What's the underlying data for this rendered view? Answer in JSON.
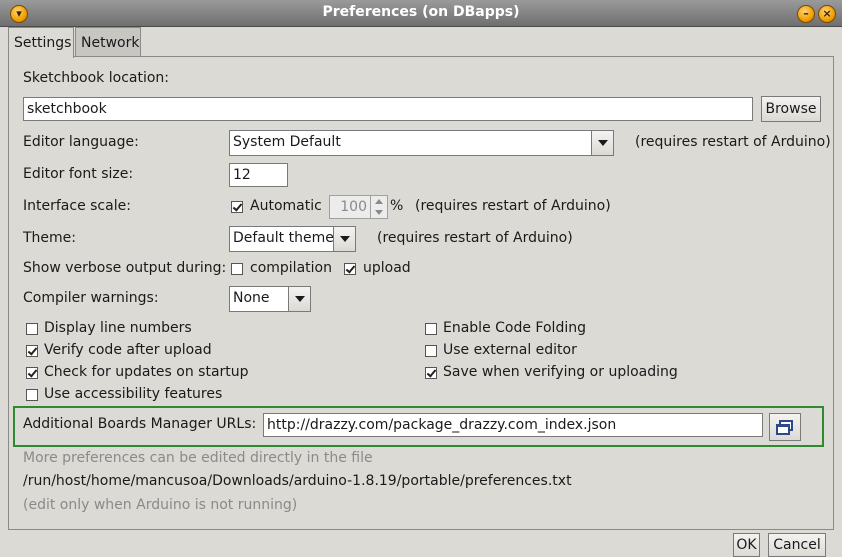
{
  "window": {
    "title": "Preferences (on DBapps)",
    "menu_icon": "chevron-down-icon",
    "minimize_icon": "minimize-icon",
    "close_icon": "close-icon"
  },
  "tabs": [
    {
      "label": "Settings",
      "active": true
    },
    {
      "label": "Network",
      "active": false
    }
  ],
  "settings": {
    "sketchbook_label": "Sketchbook location:",
    "sketchbook_value": "sketchbook",
    "browse_label": "Browse",
    "editor_language_label": "Editor language:",
    "editor_language_value": "System Default",
    "restart_note": "(requires restart of Arduino)",
    "font_size_label": "Editor font size:",
    "font_size_value": "12",
    "interface_scale_label": "Interface scale:",
    "automatic_label": "Automatic",
    "automatic_checked": true,
    "scale_value": "100",
    "percent": "%",
    "theme_label": "Theme:",
    "theme_value": "Default theme",
    "verbose_label": "Show verbose output during:",
    "compilation_label": "compilation",
    "compilation_checked": false,
    "upload_label": "upload",
    "upload_checked": true,
    "compiler_warnings_label": "Compiler warnings:",
    "compiler_warnings_value": "None",
    "left_options": [
      {
        "label": "Display line numbers",
        "checked": false
      },
      {
        "label": "Verify code after upload",
        "checked": true
      },
      {
        "label": "Check for updates on startup",
        "checked": true
      },
      {
        "label": "Use accessibility features",
        "checked": false
      }
    ],
    "right_options": [
      {
        "label": "Enable Code Folding",
        "checked": false
      },
      {
        "label": "Use external editor",
        "checked": false
      },
      {
        "label": "Save when verifying or uploading",
        "checked": true
      }
    ],
    "boards_urls_label": "Additional Boards Manager URLs:",
    "boards_urls_value": "http://drazzy.com/package_drazzy.com_index.json",
    "boards_urls_button_icon": "window-stack-icon",
    "more_prefs_note": "More preferences can be edited directly in the file",
    "prefs_path": "/run/host/home/mancusoa/Downloads/arduino-1.8.19/portable/preferences.txt",
    "edit_note": "(edit only when Arduino is not running)"
  },
  "footer": {
    "ok_label": "OK",
    "cancel_label": "Cancel"
  },
  "colors": {
    "highlight_box": "#2f8a2f",
    "window_bg": "#dcdad5"
  }
}
